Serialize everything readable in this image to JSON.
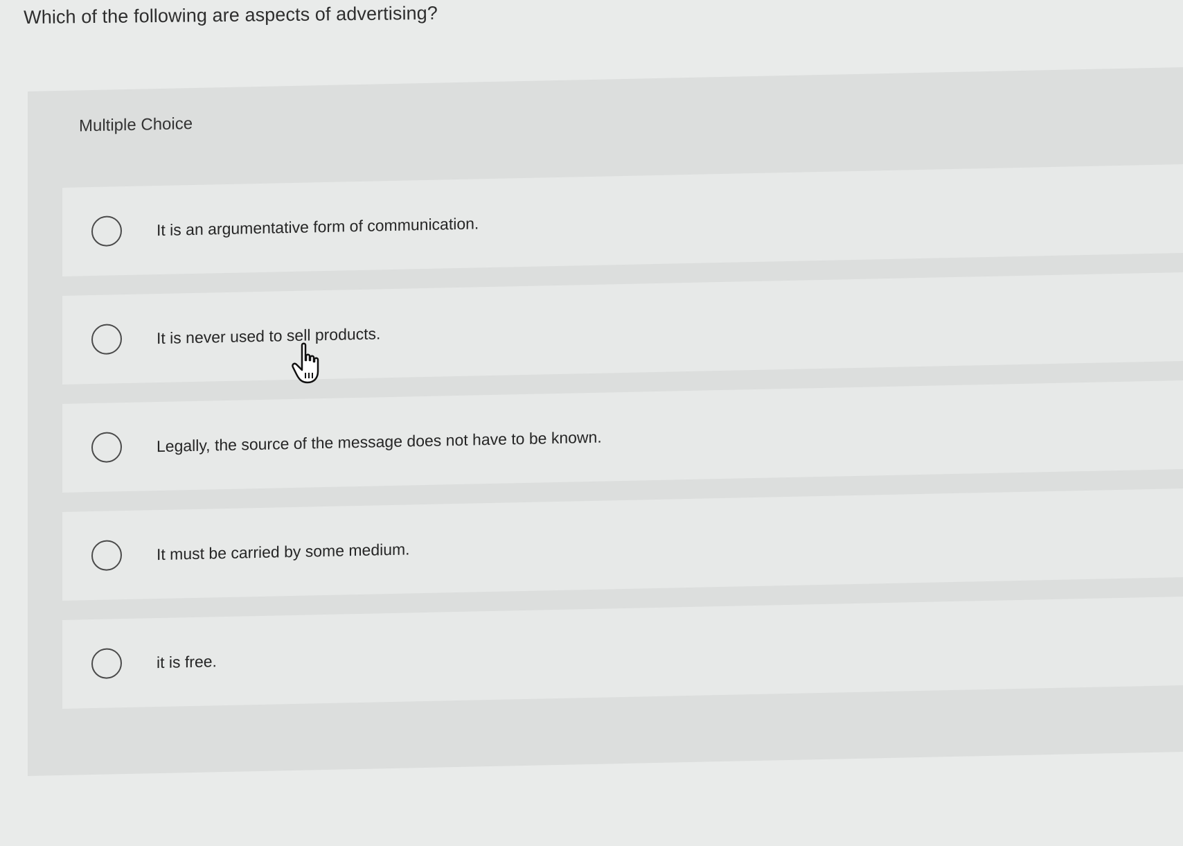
{
  "question": {
    "text": "Which of the following are aspects of advertising?"
  },
  "panel": {
    "type_label": "Multiple Choice"
  },
  "options": [
    {
      "label": "It is an argumentative form of communication.",
      "selected": false
    },
    {
      "label": "It is never used to sell products.",
      "selected": false
    },
    {
      "label": "Legally, the source of the message does not have to be known.",
      "selected": false
    },
    {
      "label": "It must be carried by some medium.",
      "selected": false
    },
    {
      "label": "it is free.",
      "selected": false
    }
  ],
  "cursor": {
    "icon": "hand-pointer-icon"
  }
}
